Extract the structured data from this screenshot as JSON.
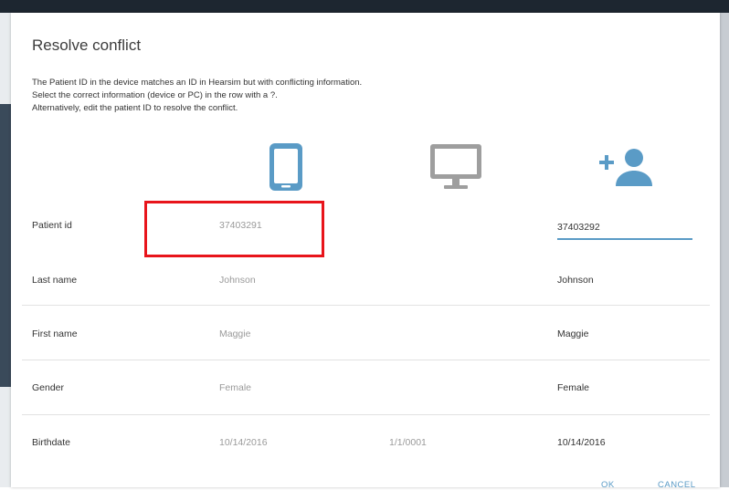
{
  "dialog": {
    "title": "Resolve conflict",
    "description": [
      "The Patient ID in the device matches an ID in Hearsim but with conflicting information.",
      "Select the correct information (device or PC) in the row with a ?.",
      "Alternatively, edit the patient ID to resolve the conflict."
    ]
  },
  "columns": {
    "device_icon": "smartphone-icon",
    "pc_icon": "desktop-monitor-icon",
    "new_icon": "add-person-icon"
  },
  "rows": {
    "patient_id": {
      "label": "Patient id",
      "device": "37403291",
      "pc": "",
      "new": "37403292"
    },
    "last_name": {
      "label": "Last name",
      "device": "Johnson",
      "pc": "",
      "new": "Johnson"
    },
    "first_name": {
      "label": "First name",
      "device": "Maggie",
      "pc": "",
      "new": "Maggie"
    },
    "gender": {
      "label": "Gender",
      "device": "Female",
      "pc": "",
      "new": "Female"
    },
    "birthdate": {
      "label": "Birthdate",
      "device": "10/14/2016",
      "pc": "1/1/0001",
      "new": "10/14/2016"
    }
  },
  "footer": {
    "ok_label": "OK",
    "cancel_label": "CANCEL"
  },
  "colors": {
    "accent": "#5a9bc6",
    "device_icon": "#5a9bc6",
    "pc_icon": "#9e9e9e",
    "highlight": "#e8141b"
  }
}
